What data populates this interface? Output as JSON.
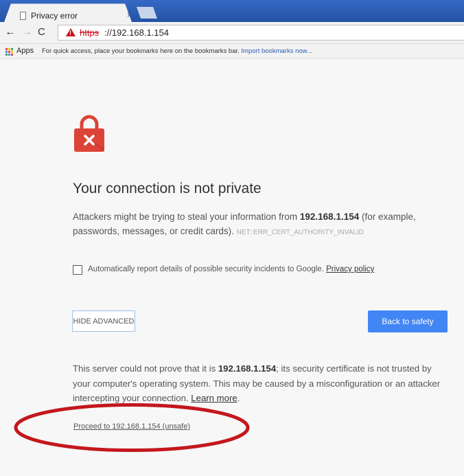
{
  "browser": {
    "tab_title": "Privacy error",
    "tab_close": "×",
    "url_scheme": "https",
    "url_rest": "://192.168.1.154",
    "back_glyph": "←",
    "forward_glyph": "→",
    "reload_glyph": "C",
    "icons": [
      "page-icon",
      "close-icon",
      "back-arrow-icon",
      "forward-arrow-icon",
      "reload-icon",
      "warning-icon",
      "apps-icon"
    ]
  },
  "bookmarks": {
    "apps_label": "Apps",
    "hint_text": "For quick access, place your bookmarks here on the bookmarks bar.",
    "import_link": "Import bookmarks now..."
  },
  "page": {
    "heading": "Your connection is not private",
    "explanation_pre": "Attackers might be trying to steal your information from ",
    "host": "192.168.1.154",
    "explanation_post": " (for example, passwords, messages, or credit cards). ",
    "error_code": "NET::ERR_CERT_AUTHORITY_INVALID",
    "report_text": "Automatically report details of possible security incidents to Google. ",
    "privacy_policy": "Privacy policy",
    "hide_advanced": "HIDE ADVANCED",
    "back_to_safety": "Back to safety",
    "details_pre": "This server could not prove that it is ",
    "details_host": "192.168.1.154",
    "details_post": "; its security certificate is not trusted by your computer's operating system. This may be caused by a misconfiguration or an attacker intercepting your connection. ",
    "learn_more": "Learn more",
    "details_end": ".",
    "proceed_link": "Proceed to 192.168.1.154 (unsafe)"
  },
  "colors": {
    "tabstrip": "#2a58a8",
    "error_red": "#c8101e",
    "lock_red": "#db4437",
    "primary_blue": "#4285f4",
    "annotation_red": "#c4171d"
  },
  "report_checkbox_checked": false
}
